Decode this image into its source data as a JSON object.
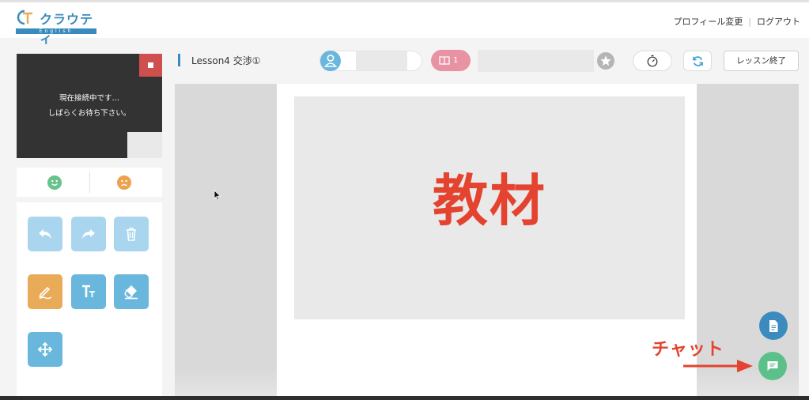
{
  "header": {
    "logo_text": "クラウティ",
    "logo_subtext": "English",
    "profile_link": "プロフィール変更",
    "separator": "|",
    "logout_link": "ログアウト"
  },
  "video": {
    "status_line1": "現在接続中です…",
    "status_line2": "しばらくお待ち下さい。"
  },
  "toolbar": {
    "lesson_title": "Lesson4 交渉①",
    "material_page": "1",
    "end_button": "レッスン終了"
  },
  "stage": {
    "slide_text": "教材"
  },
  "annotation": {
    "chat_label": "チャット"
  },
  "colors": {
    "brand": "#3a8bbd",
    "accent_red": "#e4432f",
    "tool_blue": "#6ab7de",
    "tool_disabled": "#a9d6ee",
    "tool_orange": "#e9ab57",
    "chat_green": "#5cc08a",
    "material_pink": "#e893a4"
  },
  "icons": [
    "logo-icon",
    "stop-icon",
    "happy-face-icon",
    "sad-face-icon",
    "undo-icon",
    "redo-icon",
    "trash-icon",
    "pen-icon",
    "text-icon",
    "eraser-icon",
    "move-icon",
    "person-icon",
    "book-icon",
    "star-icon",
    "timer-icon",
    "refresh-icon",
    "document-icon",
    "chat-icon",
    "cursor-icon",
    "arrow-icon"
  ]
}
